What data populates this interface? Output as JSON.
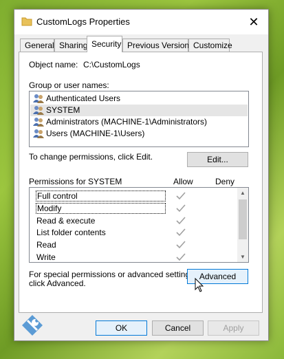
{
  "window": {
    "title": "CustomLogs Properties",
    "close_label": "✕"
  },
  "tabs": [
    "General",
    "Sharing",
    "Security",
    "Previous Versions",
    "Customize"
  ],
  "object": {
    "label": "Object name:",
    "value": "C:\\CustomLogs"
  },
  "groups": {
    "label": "Group or user names:",
    "items": [
      "Authenticated Users",
      "SYSTEM",
      "Administrators (MACHINE-1\\Administrators)",
      "Users (MACHINE-1\\Users)"
    ],
    "selected_index": 1
  },
  "change_permissions": {
    "text": "To change permissions, click Edit.",
    "edit_label": "Edit..."
  },
  "permissions": {
    "title": "Permissions for SYSTEM",
    "allow_header": "Allow",
    "deny_header": "Deny",
    "rows": [
      {
        "name": "Full control",
        "allow": true,
        "deny": false
      },
      {
        "name": "Modify",
        "allow": true,
        "deny": false
      },
      {
        "name": "Read & execute",
        "allow": true,
        "deny": false
      },
      {
        "name": "List folder contents",
        "allow": true,
        "deny": false
      },
      {
        "name": "Read",
        "allow": true,
        "deny": false
      },
      {
        "name": "Write",
        "allow": true,
        "deny": false
      }
    ]
  },
  "special": {
    "line1": "For special permissions or advanced settings,",
    "line2": "click Advanced.",
    "advanced_label": "Advanced"
  },
  "footer": {
    "ok_label": "OK",
    "cancel_label": "Cancel",
    "apply_label": "Apply"
  },
  "colors": {
    "accent": "#0078d7",
    "selected_row": "#e5e5e5",
    "check": "#a0a0a0"
  }
}
